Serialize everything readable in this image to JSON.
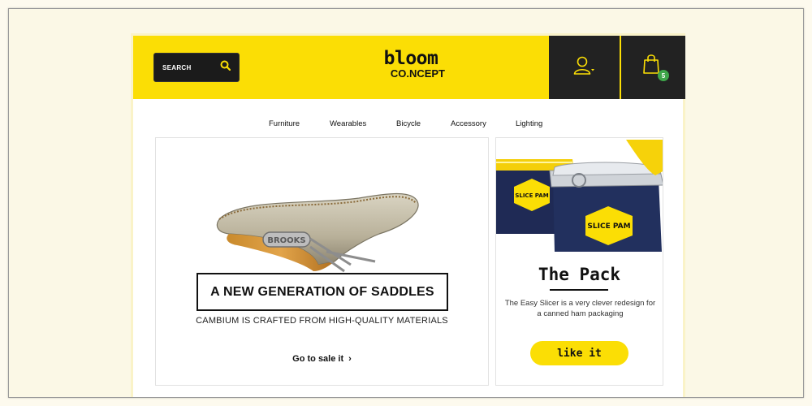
{
  "header": {
    "search_label": "SEARCH",
    "logo_main": "bloom",
    "logo_sub": "CO.NCEPT",
    "cart_count": "5",
    "colors": {
      "brand_yellow": "#fbde05",
      "dark": "#222222",
      "badge_green": "#3ea64a"
    }
  },
  "nav": {
    "items": [
      "Furniture",
      "Wearables",
      "Bicycle",
      "Accessory",
      "Lighting"
    ]
  },
  "hero": {
    "headline": "A NEW GENERATION OF SADDLES",
    "subline": "CAMBIUM IS CRAFTED FROM HIGH-QUALITY MATERIALS",
    "link": "Go to sale it",
    "chevron": "›",
    "saddle_brand": "BROOKS"
  },
  "promo": {
    "title": "The Pack",
    "description": "The Easy Slicer is a very clever redesign for a canned ham packaging",
    "button": "like it",
    "can_label": "SLICE PAM"
  }
}
